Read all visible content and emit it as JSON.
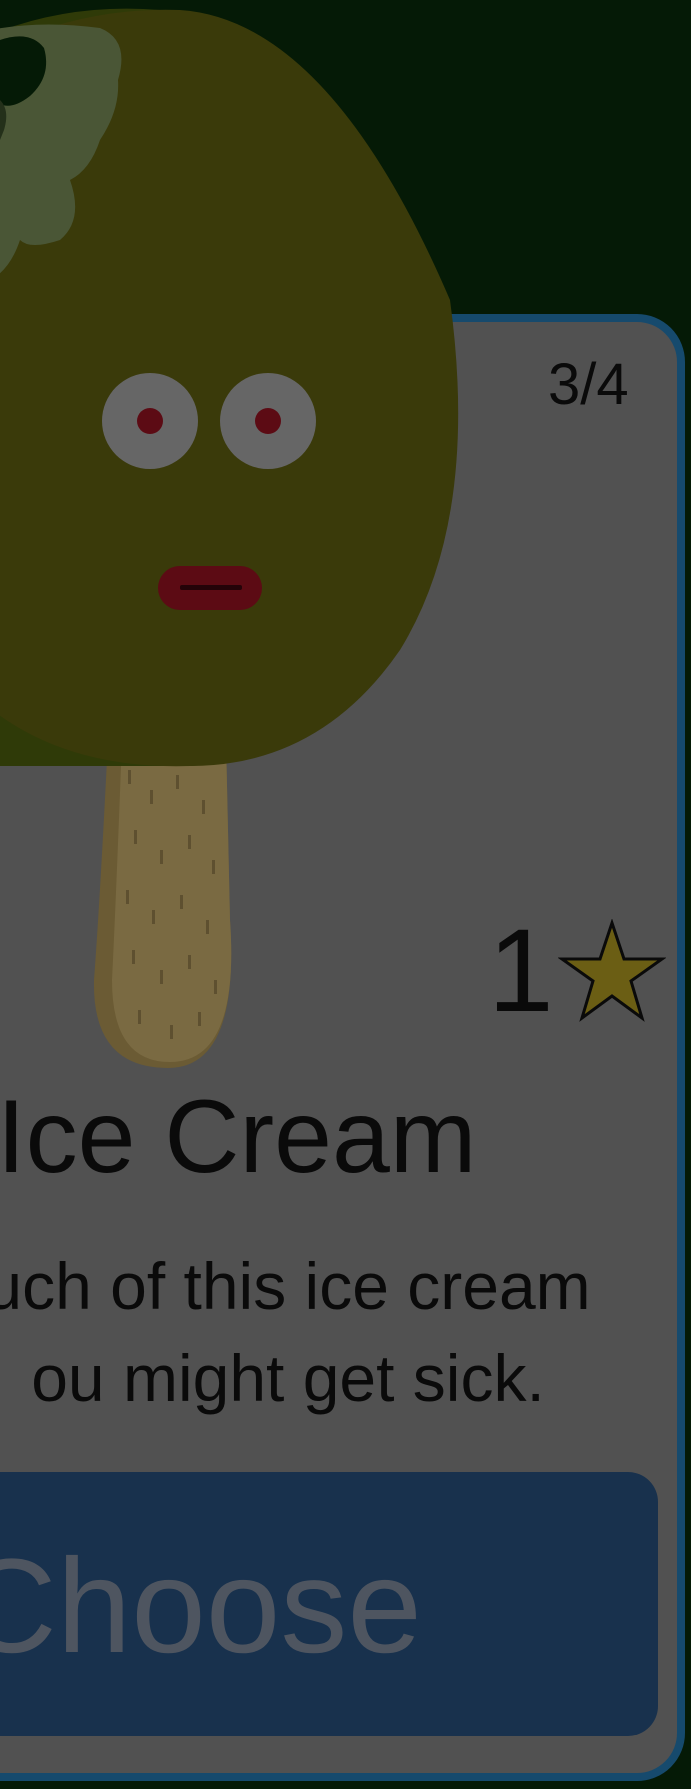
{
  "card": {
    "counter": "3/4",
    "stars_count": "1",
    "star_icon": "star-icon",
    "title": "n Ice Cream",
    "description_lines": [
      "uch of this ice cream",
      "ou might get sick."
    ],
    "choose_label": "Choose"
  },
  "character": {
    "name_icon": "ice-cream-popsicle-character"
  },
  "colors": {
    "background": "#051a06",
    "card": "#515151",
    "card_border": "#164a6d",
    "button": "#18314d",
    "popsicle": "#3a3a0a",
    "star": "#6b5e14"
  }
}
